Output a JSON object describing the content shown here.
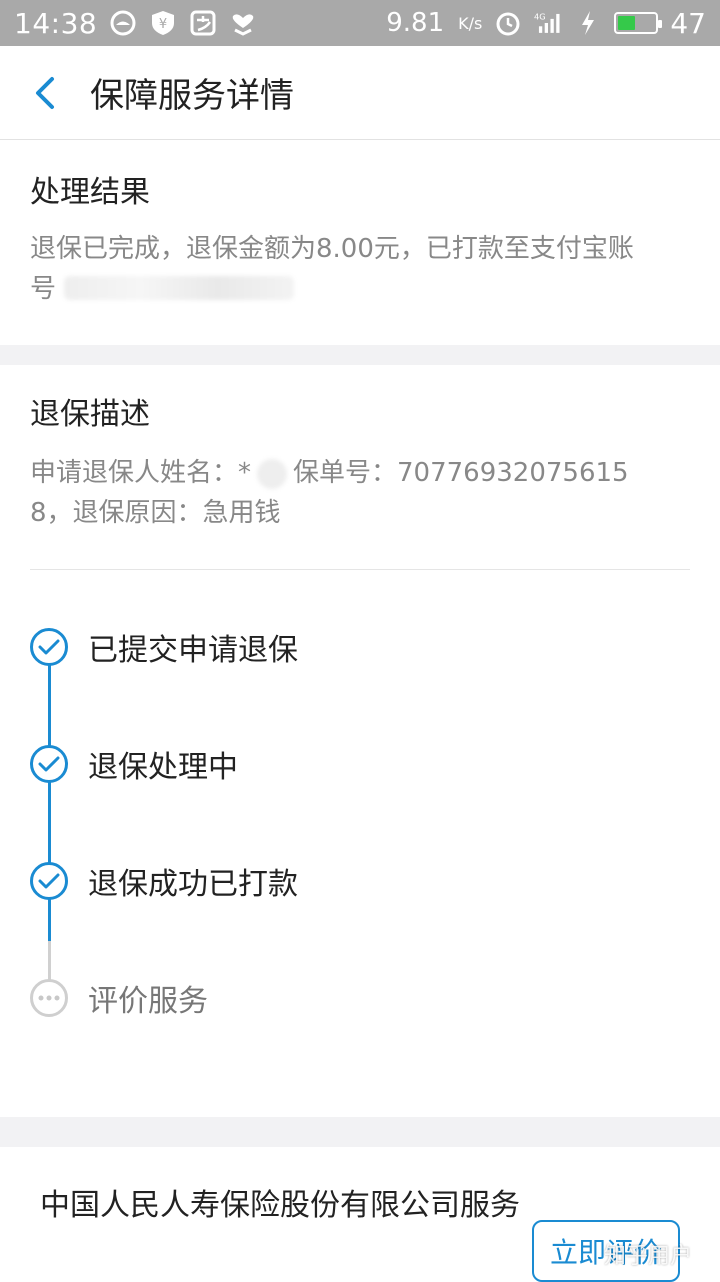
{
  "status_bar": {
    "time": "14:38",
    "net_speed": "9.81",
    "net_unit": "K/s",
    "signal": "4G",
    "battery_level": "47"
  },
  "header": {
    "title": "保障服务详情"
  },
  "result": {
    "title": "处理结果",
    "text": "退保已完成，退保金额为8.00元，已打款至支付宝账",
    "text_cont": "号"
  },
  "description": {
    "title": "退保描述",
    "applicant_label": "申请退保人姓名：*",
    "policy_text": "保单号：70776932075615",
    "text_line2": "8，退保原因：急用钱"
  },
  "timeline": [
    {
      "label": "已提交申请退保",
      "status": "done"
    },
    {
      "label": "退保处理中",
      "status": "done"
    },
    {
      "label": "退保成功已打款",
      "status": "done"
    },
    {
      "label": "评价服务",
      "status": "pending"
    }
  ],
  "footer": {
    "company": "中国人民人寿保险股份有限公司服务",
    "rate_button": "立即评价",
    "watermark": "知乎用户"
  },
  "colors": {
    "accent": "#1a8bd2",
    "pending": "#cfcfcf",
    "band": "#f2f2f4"
  }
}
